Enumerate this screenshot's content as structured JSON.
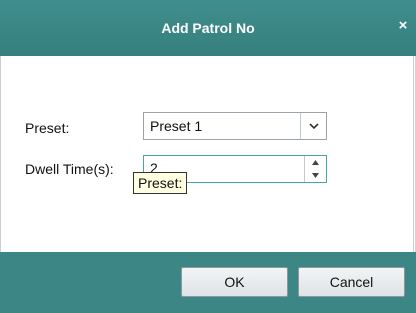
{
  "dialog": {
    "title": "Add Patrol No",
    "close_glyph": "×"
  },
  "form": {
    "preset_label": "Preset:",
    "preset_value": "Preset 1",
    "dwell_label": "Dwell Time(s):",
    "dwell_value": "2"
  },
  "tooltip": {
    "text": "Preset:"
  },
  "buttons": {
    "ok_label": "OK",
    "cancel_label": "Cancel"
  },
  "icons": {
    "dropdown": "chevron-down-icon",
    "spin_up": "arrow-up-icon",
    "spin_down": "arrow-down-icon",
    "close": "close-icon"
  },
  "colors": {
    "titlebar": "#3f8e8d",
    "footer": "#3d8686",
    "tooltip_bg": "#ffffe1",
    "focus_border": "#4aa79f"
  }
}
